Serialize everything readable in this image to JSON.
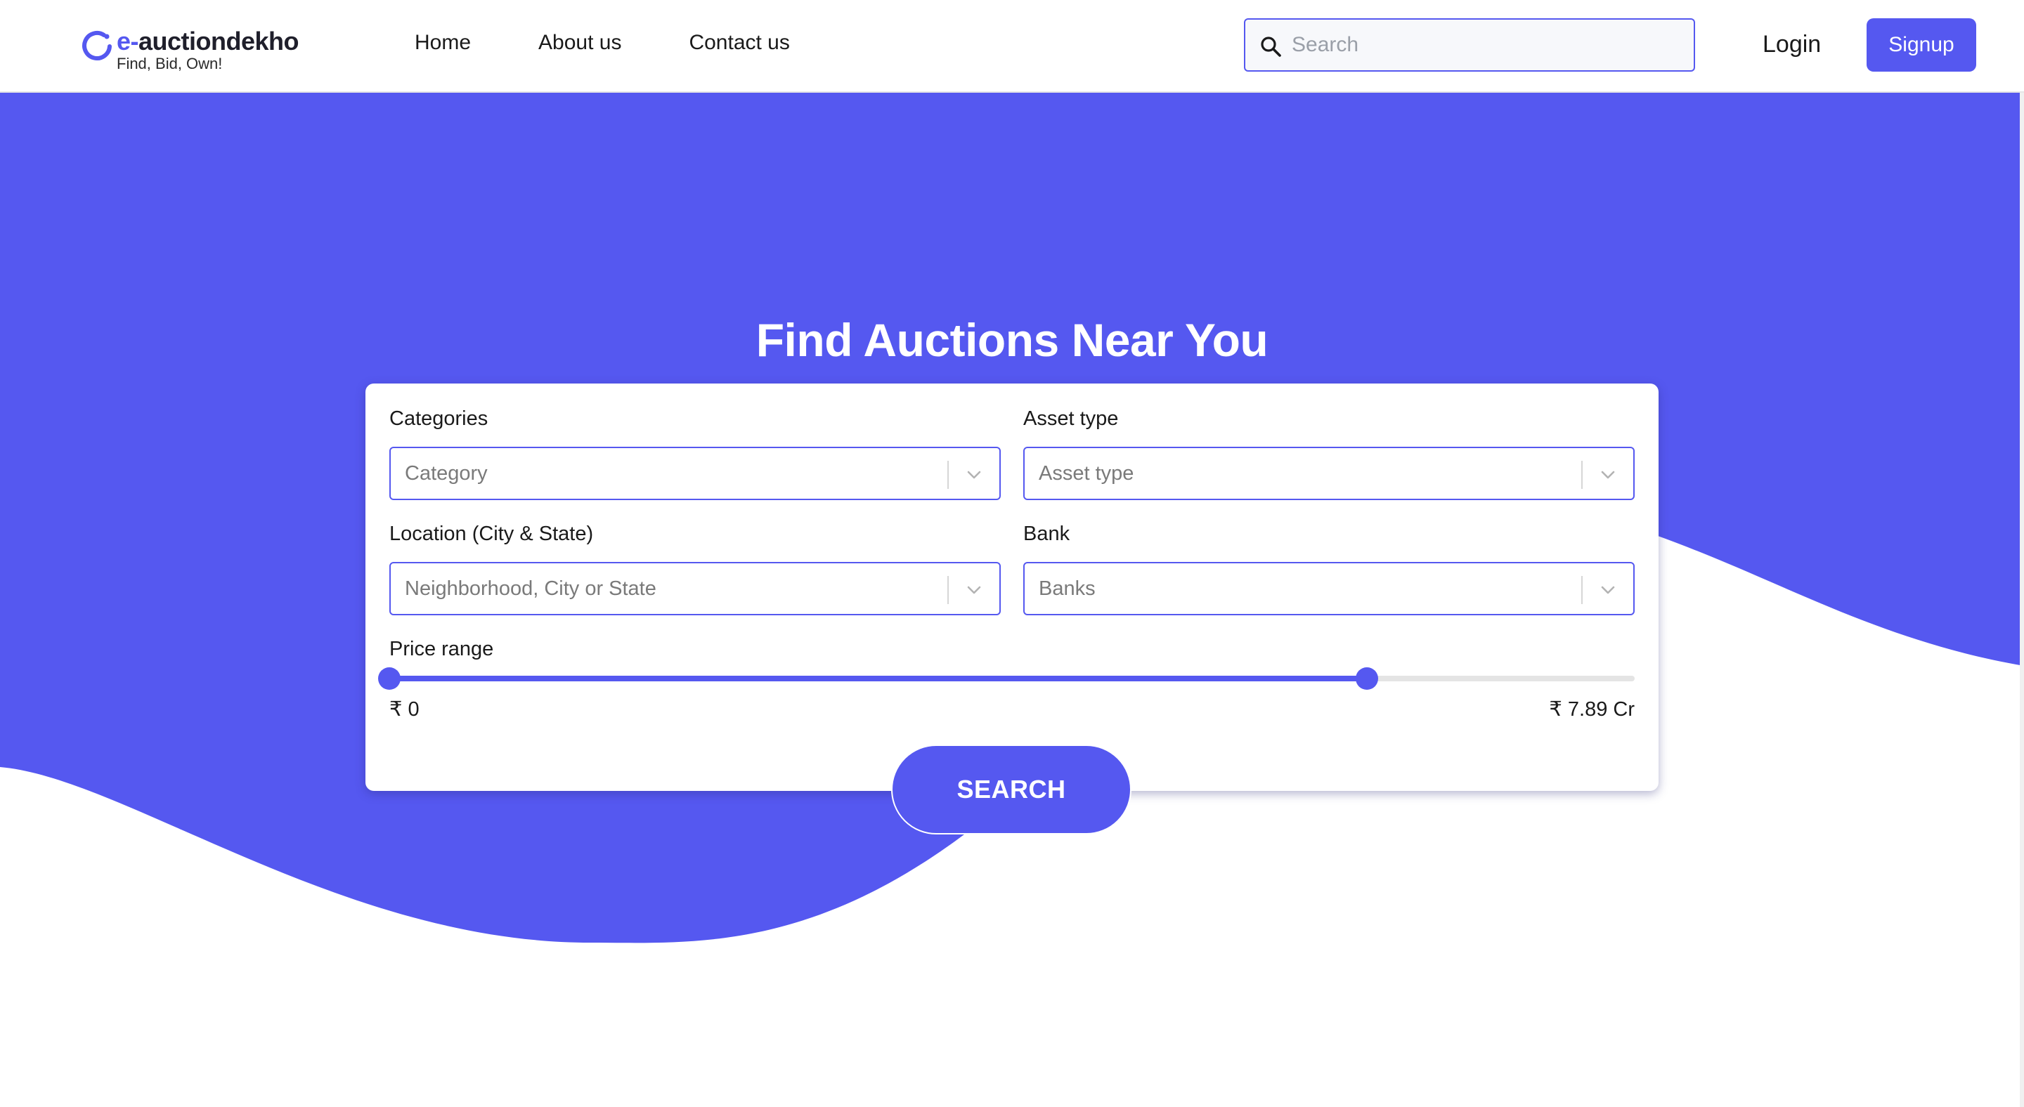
{
  "colors": {
    "accent": "#5558f0",
    "hero_bg": "#5558f0",
    "text": "#1a1a1a",
    "white": "#ffffff"
  },
  "header": {
    "logo": {
      "prefix": "e-",
      "name": "auctiondekho",
      "tagline": "Find, Bid, Own!"
    },
    "nav": [
      {
        "label": "Home"
      },
      {
        "label": "About us"
      },
      {
        "label": "Contact us"
      }
    ],
    "search": {
      "placeholder": "Search",
      "value": "",
      "icon": "search-icon"
    },
    "login_label": "Login",
    "signup_label": "Signup"
  },
  "hero": {
    "title": "Find Auctions Near You"
  },
  "filters": {
    "categories": {
      "label": "Categories",
      "placeholder": "Category",
      "icon": "chevron-down-icon"
    },
    "asset_type": {
      "label": "Asset type",
      "placeholder": "Asset type",
      "icon": "chevron-down-icon"
    },
    "location": {
      "label": "Location (City & State)",
      "placeholder": "Neighborhood, City or State",
      "icon": "chevron-down-icon"
    },
    "bank": {
      "label": "Bank",
      "placeholder": "Banks",
      "icon": "chevron-down-icon"
    },
    "price": {
      "label": "Price range",
      "min_label": "₹ 0",
      "max_label": "₹ 7.89 Cr",
      "low_fraction": 0.0,
      "high_fraction": 0.785
    },
    "search_label": "SEARCH"
  }
}
